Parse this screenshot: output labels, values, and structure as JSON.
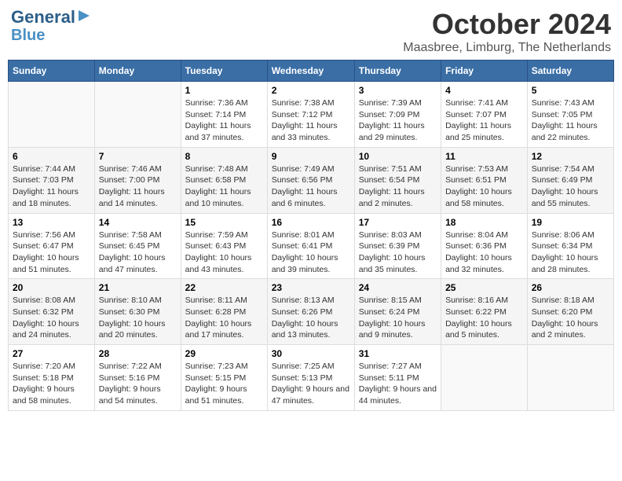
{
  "header": {
    "logo_line1": "General",
    "logo_line2": "Blue",
    "month": "October 2024",
    "location": "Maasbree, Limburg, The Netherlands"
  },
  "days_of_week": [
    "Sunday",
    "Monday",
    "Tuesday",
    "Wednesday",
    "Thursday",
    "Friday",
    "Saturday"
  ],
  "weeks": [
    [
      {
        "day": "",
        "detail": ""
      },
      {
        "day": "",
        "detail": ""
      },
      {
        "day": "1",
        "detail": "Sunrise: 7:36 AM\nSunset: 7:14 PM\nDaylight: 11 hours and 37 minutes."
      },
      {
        "day": "2",
        "detail": "Sunrise: 7:38 AM\nSunset: 7:12 PM\nDaylight: 11 hours and 33 minutes."
      },
      {
        "day": "3",
        "detail": "Sunrise: 7:39 AM\nSunset: 7:09 PM\nDaylight: 11 hours and 29 minutes."
      },
      {
        "day": "4",
        "detail": "Sunrise: 7:41 AM\nSunset: 7:07 PM\nDaylight: 11 hours and 25 minutes."
      },
      {
        "day": "5",
        "detail": "Sunrise: 7:43 AM\nSunset: 7:05 PM\nDaylight: 11 hours and 22 minutes."
      }
    ],
    [
      {
        "day": "6",
        "detail": "Sunrise: 7:44 AM\nSunset: 7:03 PM\nDaylight: 11 hours and 18 minutes."
      },
      {
        "day": "7",
        "detail": "Sunrise: 7:46 AM\nSunset: 7:00 PM\nDaylight: 11 hours and 14 minutes."
      },
      {
        "day": "8",
        "detail": "Sunrise: 7:48 AM\nSunset: 6:58 PM\nDaylight: 11 hours and 10 minutes."
      },
      {
        "day": "9",
        "detail": "Sunrise: 7:49 AM\nSunset: 6:56 PM\nDaylight: 11 hours and 6 minutes."
      },
      {
        "day": "10",
        "detail": "Sunrise: 7:51 AM\nSunset: 6:54 PM\nDaylight: 11 hours and 2 minutes."
      },
      {
        "day": "11",
        "detail": "Sunrise: 7:53 AM\nSunset: 6:51 PM\nDaylight: 10 hours and 58 minutes."
      },
      {
        "day": "12",
        "detail": "Sunrise: 7:54 AM\nSunset: 6:49 PM\nDaylight: 10 hours and 55 minutes."
      }
    ],
    [
      {
        "day": "13",
        "detail": "Sunrise: 7:56 AM\nSunset: 6:47 PM\nDaylight: 10 hours and 51 minutes."
      },
      {
        "day": "14",
        "detail": "Sunrise: 7:58 AM\nSunset: 6:45 PM\nDaylight: 10 hours and 47 minutes."
      },
      {
        "day": "15",
        "detail": "Sunrise: 7:59 AM\nSunset: 6:43 PM\nDaylight: 10 hours and 43 minutes."
      },
      {
        "day": "16",
        "detail": "Sunrise: 8:01 AM\nSunset: 6:41 PM\nDaylight: 10 hours and 39 minutes."
      },
      {
        "day": "17",
        "detail": "Sunrise: 8:03 AM\nSunset: 6:39 PM\nDaylight: 10 hours and 35 minutes."
      },
      {
        "day": "18",
        "detail": "Sunrise: 8:04 AM\nSunset: 6:36 PM\nDaylight: 10 hours and 32 minutes."
      },
      {
        "day": "19",
        "detail": "Sunrise: 8:06 AM\nSunset: 6:34 PM\nDaylight: 10 hours and 28 minutes."
      }
    ],
    [
      {
        "day": "20",
        "detail": "Sunrise: 8:08 AM\nSunset: 6:32 PM\nDaylight: 10 hours and 24 minutes."
      },
      {
        "day": "21",
        "detail": "Sunrise: 8:10 AM\nSunset: 6:30 PM\nDaylight: 10 hours and 20 minutes."
      },
      {
        "day": "22",
        "detail": "Sunrise: 8:11 AM\nSunset: 6:28 PM\nDaylight: 10 hours and 17 minutes."
      },
      {
        "day": "23",
        "detail": "Sunrise: 8:13 AM\nSunset: 6:26 PM\nDaylight: 10 hours and 13 minutes."
      },
      {
        "day": "24",
        "detail": "Sunrise: 8:15 AM\nSunset: 6:24 PM\nDaylight: 10 hours and 9 minutes."
      },
      {
        "day": "25",
        "detail": "Sunrise: 8:16 AM\nSunset: 6:22 PM\nDaylight: 10 hours and 5 minutes."
      },
      {
        "day": "26",
        "detail": "Sunrise: 8:18 AM\nSunset: 6:20 PM\nDaylight: 10 hours and 2 minutes."
      }
    ],
    [
      {
        "day": "27",
        "detail": "Sunrise: 7:20 AM\nSunset: 5:18 PM\nDaylight: 9 hours and 58 minutes."
      },
      {
        "day": "28",
        "detail": "Sunrise: 7:22 AM\nSunset: 5:16 PM\nDaylight: 9 hours and 54 minutes."
      },
      {
        "day": "29",
        "detail": "Sunrise: 7:23 AM\nSunset: 5:15 PM\nDaylight: 9 hours and 51 minutes."
      },
      {
        "day": "30",
        "detail": "Sunrise: 7:25 AM\nSunset: 5:13 PM\nDaylight: 9 hours and 47 minutes."
      },
      {
        "day": "31",
        "detail": "Sunrise: 7:27 AM\nSunset: 5:11 PM\nDaylight: 9 hours and 44 minutes."
      },
      {
        "day": "",
        "detail": ""
      },
      {
        "day": "",
        "detail": ""
      }
    ]
  ]
}
